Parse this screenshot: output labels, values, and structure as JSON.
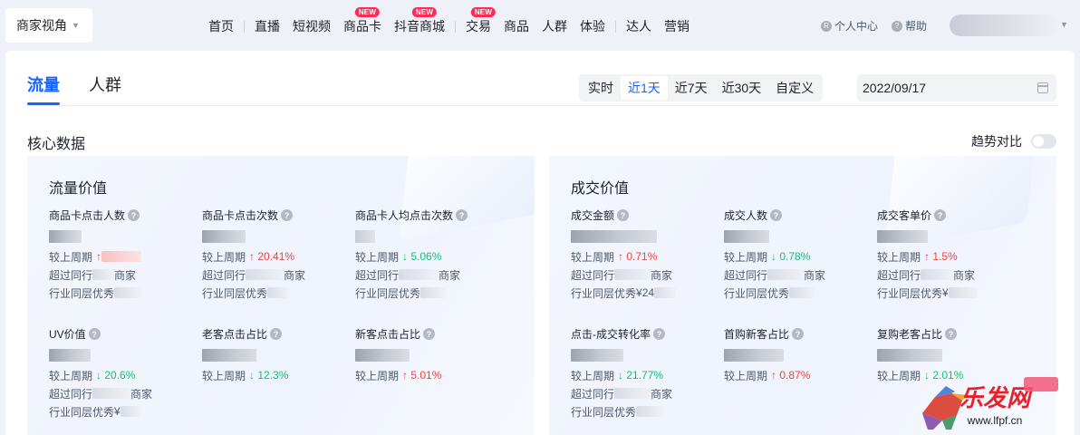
{
  "topbar": {
    "shop_view": "商家视角",
    "nav": [
      {
        "label": "首页",
        "badge": ""
      },
      {
        "label": "直播",
        "badge": ""
      },
      {
        "label": "短视频",
        "badge": ""
      },
      {
        "label": "商品卡",
        "badge": "NEW"
      },
      {
        "label": "抖音商城",
        "badge": "NEW"
      },
      {
        "label": "交易",
        "badge": "NEW"
      },
      {
        "label": "商品",
        "badge": ""
      },
      {
        "label": "人群",
        "badge": ""
      },
      {
        "label": "体验",
        "badge": ""
      },
      {
        "label": "达人",
        "badge": ""
      },
      {
        "label": "营销",
        "badge": ""
      }
    ],
    "personal_center": "个人中心",
    "help": "帮助"
  },
  "tabs": [
    "流量",
    "人群"
  ],
  "range": {
    "options": [
      "实时",
      "近1天",
      "近7天",
      "近30天",
      "自定义"
    ],
    "selected": "近1天",
    "date": "2022/09/17"
  },
  "core": {
    "title": "核心数据",
    "trend_compare": "趋势对比"
  },
  "labels": {
    "prev_period": "较上周期",
    "exceed_peers": "超过同行",
    "merchant": "商家",
    "industry_excellent": "行业同层优秀"
  },
  "traffic": {
    "title": "流量价值",
    "metrics": [
      {
        "label": "商品卡点击人数",
        "delta": "",
        "dir": "up"
      },
      {
        "label": "商品卡点击次数",
        "delta": "20.41%",
        "dir": "up"
      },
      {
        "label": "商品卡人均点击次数",
        "delta": "5.06%",
        "dir": "down"
      },
      {
        "label": "UV价值",
        "delta": "20.6%",
        "dir": "down"
      },
      {
        "label": "老客点击占比",
        "delta": "12.3%",
        "dir": "down"
      },
      {
        "label": "新客点击占比",
        "delta": "5.01%",
        "dir": "up"
      }
    ]
  },
  "deal": {
    "title": "成交价值",
    "metrics": [
      {
        "label": "成交金额",
        "delta": "0.71%",
        "dir": "up"
      },
      {
        "label": "成交人数",
        "delta": "0.78%",
        "dir": "down"
      },
      {
        "label": "成交客单价",
        "delta": "1.5%",
        "dir": "up"
      },
      {
        "label": "点击-成交转化率",
        "delta": "21.77%",
        "dir": "down"
      },
      {
        "label": "首购新客占比",
        "delta": "0.87%",
        "dir": "up"
      },
      {
        "label": "复购老客占比",
        "delta": "2.01%",
        "dir": "down"
      }
    ]
  },
  "watermark": {
    "text": "乐发网",
    "url": "www.lfpf.cn",
    "colors": {
      "red": "#e8202a",
      "tag": "#f0597a"
    }
  },
  "colors": {
    "accent": "#1664ff",
    "up": "#f5413d",
    "down": "#14c079"
  }
}
